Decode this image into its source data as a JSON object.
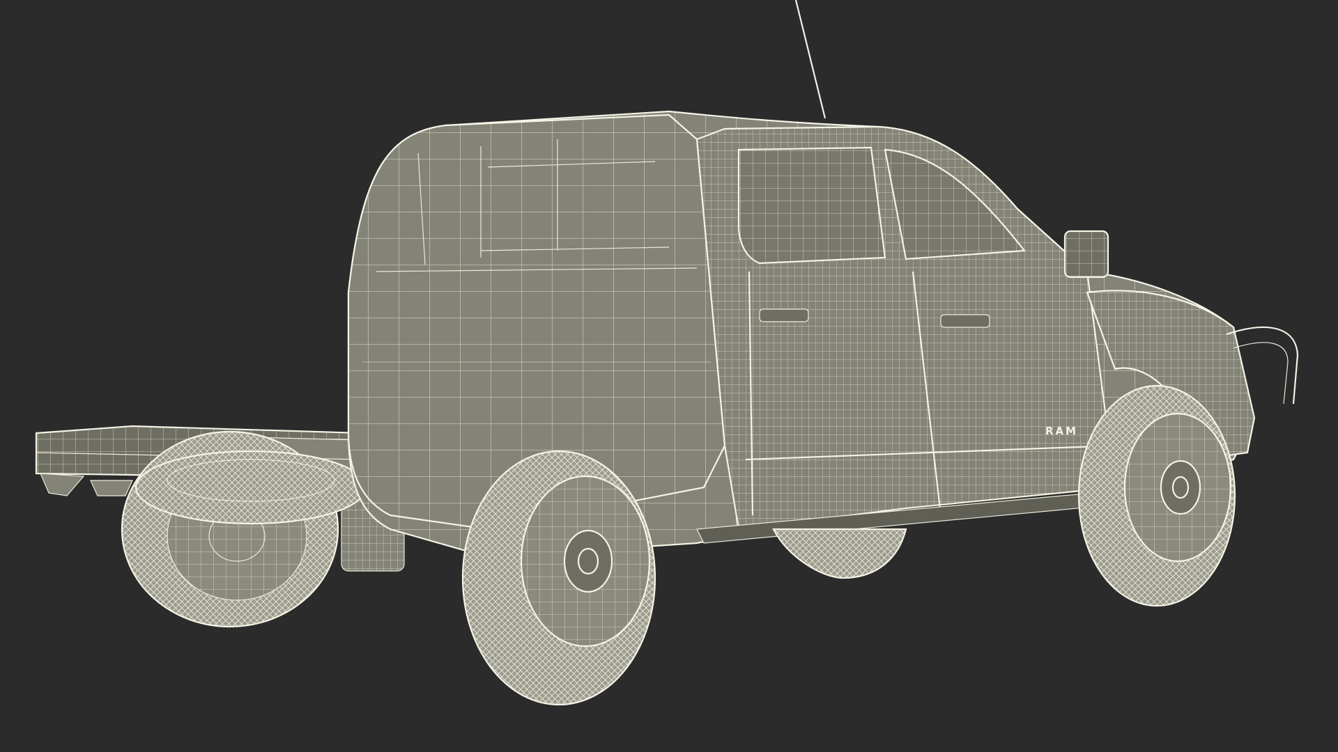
{
  "scene": {
    "background_color": "#2b2b2b",
    "wire_color": "#ecebdd",
    "body_color": "#838377",
    "badge_text": "RAM"
  },
  "icons": {
    "vehicle": "pickup-chassis-cab-wireframe",
    "antenna": "antenna-icon"
  }
}
